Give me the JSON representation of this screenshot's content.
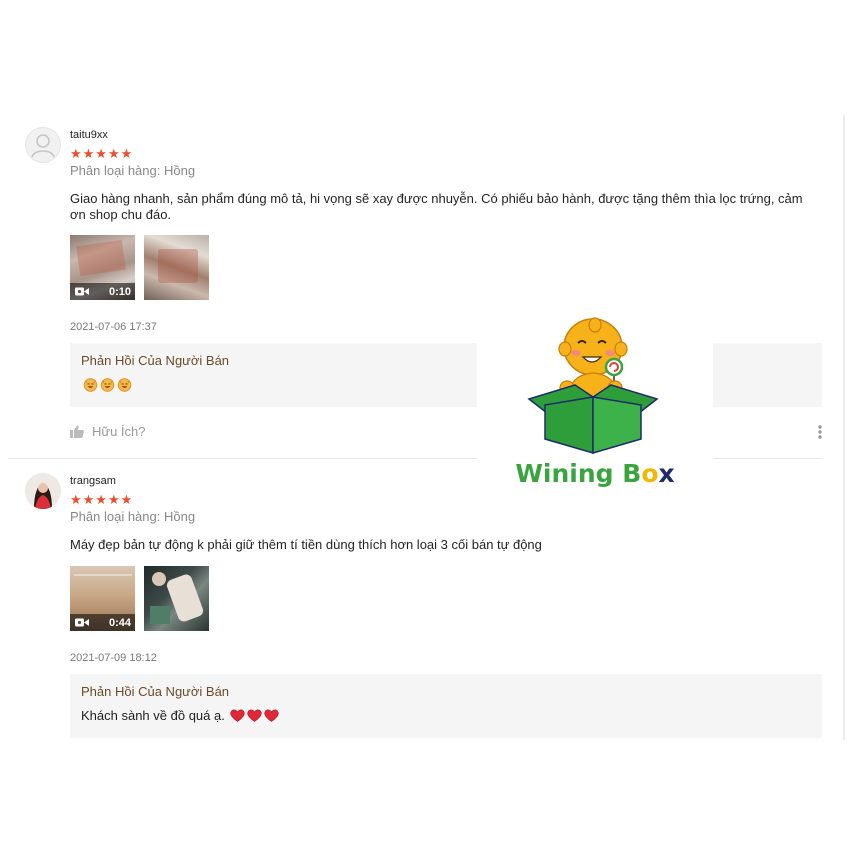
{
  "reviews": [
    {
      "username": "taitu9xx",
      "stars": "★★★★★",
      "variation": "Phân loại hàng: Hồng",
      "comment": "Giao hàng nhanh, sản phẩm đúng mô tả, hi vọng sẽ xay được nhuyễn. Có phiếu bảo hành, được tặng thêm thìa lọc trứng, cảm ơn shop chu đáo.",
      "video_duration": "0:10",
      "date": "2021-07-06 17:37",
      "reply_title": "Phản Hồi Của Người Bán",
      "reply_text": "",
      "helpful_label": "Hữu Ích?"
    },
    {
      "username": "trangsam",
      "stars": "★★★★★",
      "variation": "Phân loại hàng: Hồng",
      "comment": "Máy đẹp bản tự động k phải giữ thêm tí tiền dùng thích hơn loại 3 cối bán tự động",
      "video_duration": "0:44",
      "date": "2021-07-09 18:12",
      "reply_title": "Phản Hồi Của Người Bán",
      "reply_text": "Khách sành về đồ quá ạ."
    }
  ],
  "watermark": {
    "brand_word1": "Wining",
    "brand_b": "B",
    "brand_o": "o",
    "brand_x": "x",
    "colors": {
      "green": "#3aa53e",
      "navy": "#1f2a6b",
      "gold": "#f2b705",
      "box_green": "#2e9e3a"
    }
  },
  "colors": {
    "star": "#ee4d2d",
    "reply_bg": "#f5f5f5",
    "reply_title": "#6b4a2a",
    "heart": "#e0283a"
  },
  "icons": [
    "user-icon",
    "video-camera-icon",
    "thumbs-up-icon",
    "more-vertical-icon",
    "smile-emoji-icon",
    "heart-emoji-icon"
  ]
}
